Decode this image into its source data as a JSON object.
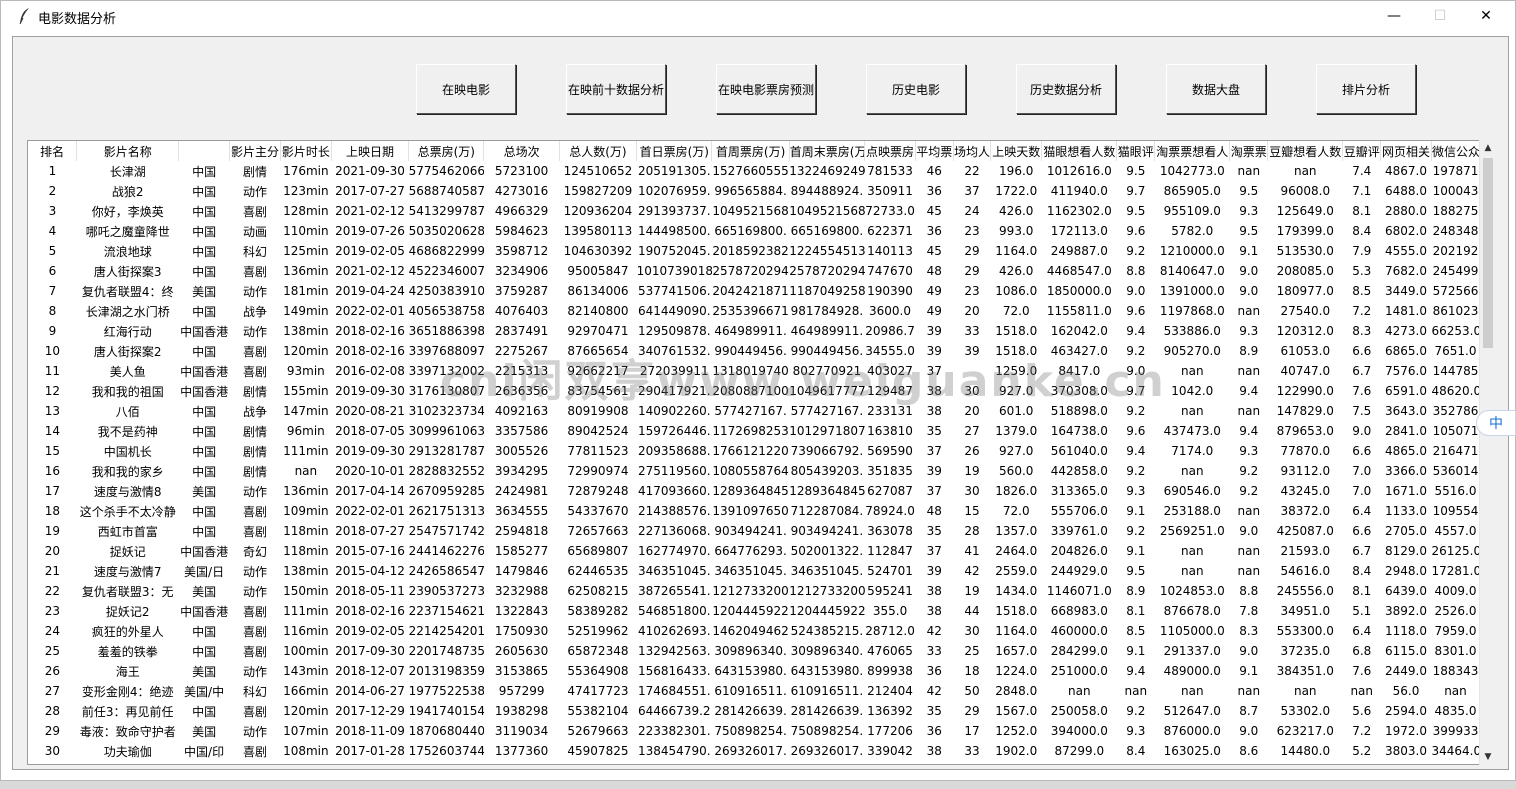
{
  "window": {
    "title": "电影数据分析",
    "minimize_glyph": "—",
    "maximize_glyph": "☐",
    "close_glyph": "✕"
  },
  "toolbar": [
    {
      "label": "在映电影"
    },
    {
      "label": "在映前十数据分析"
    },
    {
      "label": "在映电影票房预测"
    },
    {
      "label": "历史电影"
    },
    {
      "label": "历史数据分析"
    },
    {
      "label": "数据大盘"
    },
    {
      "label": "排片分析"
    }
  ],
  "table": {
    "headers": [
      "排名",
      "影片名称",
      "",
      "影片主分",
      "影片时长",
      "上映日期",
      "总票房(万)",
      "总场次",
      "总人数(万)",
      "首日票房(万)",
      "首周票房(万)",
      "首周末票房(万",
      "点映票房",
      "平均票",
      "场均人",
      "上映天数",
      "猫眼想看人数",
      "猫眼评",
      "淘票票想看人",
      "淘票票",
      "豆瓣想看人数",
      "豆瓣评",
      "网页相关",
      "微信公众"
    ],
    "rows": [
      [
        "1",
        "长津湖",
        "中国",
        "剧情",
        "176min",
        "2021-09-30",
        "5775462066",
        "5723100",
        "124510652",
        "205191305.",
        "1527660555",
        "1322469249",
        "781533",
        "46",
        "22",
        "196.0",
        "1012616.0",
        "9.5",
        "1042773.0",
        "nan",
        "nan",
        "7.4",
        "4867.0",
        "197871"
      ],
      [
        "2",
        "战狼2",
        "中国",
        "动作",
        "123min",
        "2017-07-27",
        "5688740587",
        "4273016",
        "159827209",
        "102076959.",
        "996565884.",
        "894488924.",
        "350911",
        "36",
        "37",
        "1722.0",
        "411940.0",
        "9.7",
        "865905.0",
        "9.5",
        "96008.0",
        "7.1",
        "6488.0",
        "100043"
      ],
      [
        "3",
        "你好，李焕英",
        "中国",
        "喜剧",
        "128min",
        "2021-02-12",
        "5413299787",
        "4966329",
        "120936204",
        "291393737.",
        "1049521568",
        "1049521568",
        "72733.0",
        "45",
        "24",
        "426.0",
        "1162302.0",
        "9.5",
        "955109.0",
        "9.3",
        "125649.0",
        "8.1",
        "2880.0",
        "188275"
      ],
      [
        "4",
        "哪吒之魔童降世",
        "中国",
        "动画",
        "110min",
        "2019-07-26",
        "5035020628",
        "5984623",
        "139580113",
        "144498500.",
        "665169800.",
        "665169800.",
        "622371",
        "36",
        "23",
        "993.0",
        "172113.0",
        "9.6",
        "5782.0",
        "9.5",
        "179399.0",
        "8.4",
        "6802.0",
        "248348"
      ],
      [
        "5",
        "流浪地球",
        "中国",
        "科幻",
        "125min",
        "2019-02-05",
        "4686822999",
        "3598712",
        "104630392",
        "190752045.",
        "2018592382",
        "1224554513",
        "140113",
        "45",
        "29",
        "1164.0",
        "249887.0",
        "9.2",
        "1210000.0",
        "9.1",
        "513530.0",
        "7.9",
        "4555.0",
        "202192"
      ],
      [
        "6",
        "唐人街探案3",
        "中国",
        "喜剧",
        "136min",
        "2021-02-12",
        "4522346007",
        "3234906",
        "95005847",
        "1010739018",
        "2578720294",
        "2578720294",
        "747670",
        "48",
        "29",
        "426.0",
        "4468547.0",
        "8.8",
        "8140647.0",
        "9.0",
        "208085.0",
        "5.3",
        "7682.0",
        "245499"
      ],
      [
        "7",
        "复仇者联盟4：终",
        "美国",
        "动作",
        "181min",
        "2019-04-24",
        "4250383910",
        "3759287",
        "86134006",
        "537741506.",
        "2042421871",
        "1187049258",
        "190390",
        "49",
        "23",
        "1086.0",
        "1850000.0",
        "9.0",
        "1391000.0",
        "9.0",
        "180977.0",
        "8.5",
        "3449.0",
        "572566"
      ],
      [
        "8",
        "长津湖之水门桥",
        "中国",
        "战争",
        "149min",
        "2022-02-01",
        "4056538758",
        "4076403",
        "82140800",
        "641449090.",
        "2535396671",
        "981784928.",
        "3600.0",
        "49",
        "20",
        "72.0",
        "1155811.0",
        "9.6",
        "1197868.0",
        "nan",
        "27540.0",
        "7.2",
        "1481.0",
        "861023"
      ],
      [
        "9",
        "红海行动",
        "中国香港",
        "动作",
        "138min",
        "2018-02-16",
        "3651886398",
        "2837491",
        "92970471",
        "129509878.",
        "464989911.",
        "464989911.",
        "20986.7",
        "39",
        "33",
        "1518.0",
        "162042.0",
        "9.4",
        "533886.0",
        "9.3",
        "120312.0",
        "8.3",
        "4273.0",
        "66253.0"
      ],
      [
        "10",
        "唐人街探案2",
        "中国",
        "喜剧",
        "120min",
        "2018-02-16",
        "3397688097",
        "2275267",
        "87665654",
        "340761532.",
        "990449456.",
        "990449456.",
        "34555.0",
        "39",
        "39",
        "1518.0",
        "463427.0",
        "9.2",
        "905270.0",
        "8.9",
        "61053.0",
        "6.6",
        "6865.0",
        "7651.0"
      ],
      [
        "11",
        "美人鱼",
        "中国香港",
        "喜剧",
        "93min",
        "2016-02-08",
        "3397132002",
        "2215313",
        "92662217",
        "272039911",
        "1318019740",
        "802770921",
        "403027",
        "37",
        "",
        "1259.0",
        "8417.0",
        "9.0",
        "nan",
        "nan",
        "40747.0",
        "6.7",
        "7576.0",
        "144785"
      ],
      [
        "12",
        "我和我的祖国",
        "中国香港",
        "剧情",
        "155min",
        "2019-09-30",
        "3176130807",
        "2636356",
        "83754561",
        "290417921.",
        "2080887100",
        "1049617777",
        "129487",
        "38",
        "30",
        "927.0",
        "370308.0",
        "9.7",
        "1042.0",
        "9.4",
        "122990.0",
        "7.6",
        "6591.0",
        "48620.0"
      ],
      [
        "13",
        "八佰",
        "中国",
        "战争",
        "147min",
        "2020-08-21",
        "3102323734",
        "4092163",
        "80919908",
        "140902260.",
        "577427167.",
        "577427167.",
        "233131",
        "38",
        "20",
        "601.0",
        "518898.0",
        "9.2",
        "nan",
        "nan",
        "147829.0",
        "7.5",
        "3643.0",
        "352786"
      ],
      [
        "14",
        "我不是药神",
        "中国",
        "剧情",
        "96min",
        "2018-07-05",
        "3099961063",
        "3357586",
        "89042524",
        "159726446.",
        "1172698253",
        "1012971807",
        "163810",
        "35",
        "27",
        "1379.0",
        "164738.0",
        "9.6",
        "437473.0",
        "9.4",
        "879653.0",
        "9.0",
        "2841.0",
        "105071"
      ],
      [
        "15",
        "中国机长",
        "中国",
        "剧情",
        "111min",
        "2019-09-30",
        "2913281787",
        "3005526",
        "77811523",
        "209358688.",
        "1766121220",
        "739066792.",
        "569590",
        "37",
        "26",
        "927.0",
        "561040.0",
        "9.4",
        "7174.0",
        "9.3",
        "77870.0",
        "6.6",
        "4865.0",
        "216471"
      ],
      [
        "16",
        "我和我的家乡",
        "中国",
        "剧情",
        "nan",
        "2020-10-01",
        "2828832552",
        "3934295",
        "72990974",
        "275119560.",
        "1080558764",
        "805439203.",
        "351835",
        "39",
        "19",
        "560.0",
        "442858.0",
        "9.2",
        "nan",
        "9.2",
        "93112.0",
        "7.0",
        "3366.0",
        "536014"
      ],
      [
        "17",
        "速度与激情8",
        "美国",
        "动作",
        "136min",
        "2017-04-14",
        "2670959285",
        "2424981",
        "72879248",
        "417093660.",
        "1289364845",
        "1289364845",
        "627087",
        "37",
        "30",
        "1826.0",
        "313365.0",
        "9.3",
        "690546.0",
        "9.2",
        "43245.0",
        "7.0",
        "1671.0",
        "5516.0"
      ],
      [
        "18",
        "这个杀手不太冷静",
        "中国",
        "喜剧",
        "109min",
        "2022-02-01",
        "2621751313",
        "3634555",
        "54337670",
        "214388576.",
        "1391097650",
        "712287084.",
        "78924.0",
        "48",
        "15",
        "72.0",
        "555706.0",
        "9.1",
        "253188.0",
        "nan",
        "38372.0",
        "6.4",
        "1133.0",
        "109554"
      ],
      [
        "19",
        "西虹市首富",
        "中国",
        "喜剧",
        "118min",
        "2018-07-27",
        "2547571742",
        "2594818",
        "72657663",
        "227136068.",
        "903494241.",
        "903494241.",
        "363078",
        "35",
        "28",
        "1357.0",
        "339761.0",
        "9.2",
        "2569251.0",
        "9.0",
        "425087.0",
        "6.6",
        "2705.0",
        "4557.0"
      ],
      [
        "20",
        "捉妖记",
        "中国香港",
        "奇幻",
        "118min",
        "2015-07-16",
        "2441462276",
        "1585277",
        "65689807",
        "162774970.",
        "664776293.",
        "502001322.",
        "112847",
        "37",
        "41",
        "2464.0",
        "204826.0",
        "9.1",
        "nan",
        "nan",
        "21593.0",
        "6.7",
        "8129.0",
        "26125.0"
      ],
      [
        "21",
        "速度与激情7",
        "美国/日",
        "动作",
        "138min",
        "2015-04-12",
        "2426586547",
        "1479846",
        "62446535",
        "346351045.",
        "346351045.",
        "346351045.",
        "524701",
        "39",
        "42",
        "2559.0",
        "244929.0",
        "9.5",
        "nan",
        "nan",
        "54616.0",
        "8.4",
        "2948.0",
        "17281.0"
      ],
      [
        "22",
        "复仇者联盟3：无",
        "美国",
        "动作",
        "150min",
        "2018-05-11",
        "2390537273",
        "3232988",
        "62508215",
        "387265541.",
        "1212733200",
        "1212733200",
        "595241",
        "38",
        "19",
        "1434.0",
        "1146071.0",
        "8.9",
        "1024853.0",
        "8.8",
        "245556.0",
        "8.1",
        "6439.0",
        "4009.0"
      ],
      [
        "23",
        "捉妖记2",
        "中国香港",
        "喜剧",
        "111min",
        "2018-02-16",
        "2237154621",
        "1322843",
        "58389282",
        "546851800.",
        "1204445922",
        "1204445922",
        "355.0",
        "38",
        "44",
        "1518.0",
        "668983.0",
        "8.1",
        "876678.0",
        "7.8",
        "34951.0",
        "5.1",
        "3892.0",
        "2526.0"
      ],
      [
        "24",
        "疯狂的外星人",
        "中国",
        "喜剧",
        "116min",
        "2019-02-05",
        "2214254201",
        "1750930",
        "52519962",
        "410262693.",
        "1462049462",
        "524385215.",
        "28712.0",
        "42",
        "30",
        "1164.0",
        "460000.0",
        "8.5",
        "1105000.0",
        "8.3",
        "553300.0",
        "6.4",
        "1118.0",
        "7959.0"
      ],
      [
        "25",
        "羞羞的铁拳",
        "中国",
        "喜剧",
        "100min",
        "2017-09-30",
        "2201748735",
        "2605630",
        "65872348",
        "132942563.",
        "309896340.",
        "309896340.",
        "476065",
        "33",
        "25",
        "1657.0",
        "284299.0",
        "9.1",
        "291337.0",
        "9.0",
        "37235.0",
        "6.8",
        "6115.0",
        "8301.0"
      ],
      [
        "26",
        "海王",
        "美国",
        "动作",
        "143min",
        "2018-12-07",
        "2013198359",
        "3153865",
        "55364908",
        "156816433.",
        "643153980.",
        "643153980.",
        "899938",
        "36",
        "18",
        "1224.0",
        "251000.0",
        "9.4",
        "489000.0",
        "9.1",
        "384351.0",
        "7.6",
        "2449.0",
        "188343"
      ],
      [
        "27",
        "变形金刚4：绝迹",
        "美国/中",
        "科幻",
        "166min",
        "2014-06-27",
        "1977522538",
        "957299",
        "47417723",
        "174684551.",
        "610916511.",
        "610916511.",
        "212404",
        "42",
        "50",
        "2848.0",
        "nan",
        "nan",
        "nan",
        "nan",
        "nan",
        "nan",
        "56.0",
        "nan"
      ],
      [
        "28",
        "前任3：再见前任",
        "中国",
        "喜剧",
        "120min",
        "2017-12-29",
        "1941740154",
        "1938298",
        "55382104",
        "64466739.2",
        "281426639.",
        "281426639.",
        "136392",
        "35",
        "29",
        "1567.0",
        "250058.0",
        "9.2",
        "512647.0",
        "8.7",
        "53302.0",
        "5.6",
        "2594.0",
        "4835.0"
      ],
      [
        "29",
        "毒液：致命守护者",
        "美国",
        "动作",
        "107min",
        "2018-11-09",
        "1870680440",
        "3119034",
        "52679663",
        "223382301.",
        "750898254.",
        "750898254.",
        "177206",
        "36",
        "17",
        "1252.0",
        "394000.0",
        "9.3",
        "876000.0",
        "9.0",
        "623217.0",
        "7.2",
        "1972.0",
        "399933"
      ],
      [
        "30",
        "功夫瑜伽",
        "中国/印",
        "喜剧",
        "108min",
        "2017-01-28",
        "1752603744",
        "1377360",
        "45907825",
        "138454790.",
        "269326017.",
        "269326017.",
        "339042",
        "38",
        "33",
        "1902.0",
        "87299.0",
        "8.4",
        "163025.0",
        "8.6",
        "14480.0",
        "5.2",
        "3803.0",
        "34464.0"
      ]
    ]
  },
  "watermark": "cnl闲双享www.weiguanke.cn",
  "ime": {
    "label": "中"
  }
}
